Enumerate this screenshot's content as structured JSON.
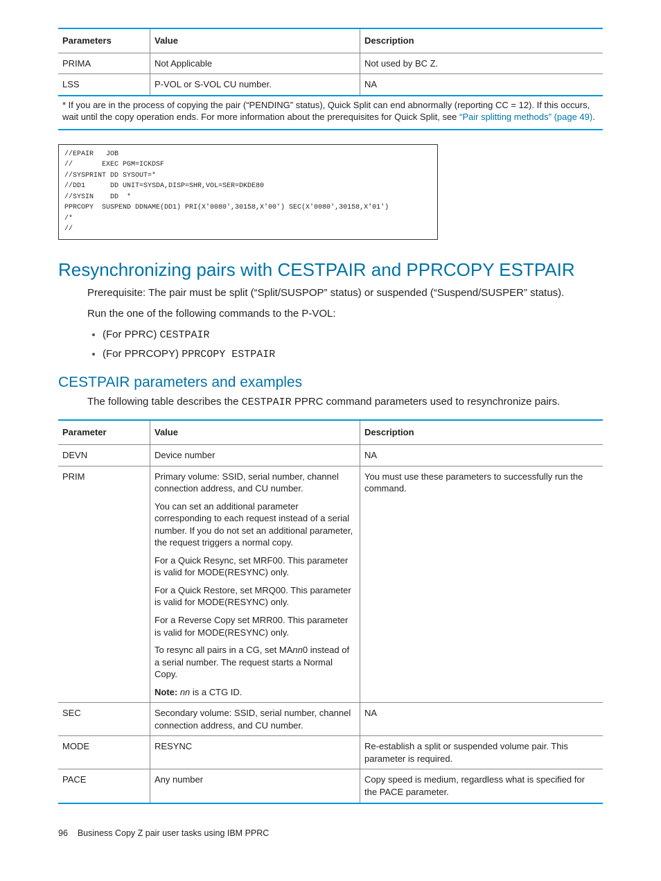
{
  "table1": {
    "headers": [
      "Parameters",
      "Value",
      "Description"
    ],
    "rows": [
      [
        "PRIMA",
        "Not Applicable",
        "Not used by BC Z."
      ],
      [
        "LSS",
        "P-VOL or S-VOL CU number.",
        "NA"
      ]
    ],
    "footnote_pre": "* If you are in the process of copying the pair (“PENDING” status), Quick Split can end abnormally (reporting CC = 12). If this occurs, wait until the copy operation ends. For more information about the prerequisites for Quick Split, see ",
    "footnote_link": "“Pair splitting methods” (page 49)",
    "footnote_post": "."
  },
  "code_block": "//EPAIR   JOB\n//       EXEC PGM=ICKDSF\n//SYSPRINT DD SYSOUT=*\n//DD1      DD UNIT=SYSDA,DISP=SHR,VOL=SER=DKDE80\n//SYSIN    DD  *\nPPRCOPY  SUSPEND DDNAME(DD1) PRI(X'0080',30158,X'00') SEC(X'0080',30158,X'01')\n/*\n//",
  "section1": {
    "title": "Resynchronizing pairs with CESTPAIR and PPRCOPY ESTPAIR",
    "prereq": "Prerequisite: The pair must be split (“Split/SUSPOP” status) or suspended (“Suspend/SUSPER” status).",
    "run": "Run the one of the following commands to the P-VOL:",
    "bullet1_a": "(For PPRC) ",
    "bullet1_b": "CESTPAIR",
    "bullet2_a": "(For PPRCOPY) ",
    "bullet2_b": "PPRCOPY ESTPAIR"
  },
  "section2": {
    "title": "CESTPAIR parameters and examples",
    "intro_a": "The following table describes the ",
    "intro_b": "CESTPAIR",
    "intro_c": " PPRC command parameters used to resynchronize pairs."
  },
  "table2": {
    "headers": [
      "Parameter",
      "Value",
      "Description"
    ],
    "row_devn": {
      "p": "DEVN",
      "v": "Device number",
      "d": "NA"
    },
    "row_prim": {
      "p": "PRIM",
      "v1": "Primary volume: SSID, serial number, channel connection address, and CU number.",
      "v2": "You can set an additional parameter corresponding to each request instead of a serial number. If you do not set an additional parameter, the request triggers a normal copy.",
      "v3": "For a Quick Resync, set MRF00. This parameter is valid for MODE(RESYNC) only.",
      "v4": "For a Quick Restore, set MRQ00. This parameter is valid for MODE(RESYNC) only.",
      "v5": "For a Reverse Copy set MRR00. This parameter is valid for MODE(RESYNC) only.",
      "v6a": "To resync all pairs in a CG, set MA",
      "v6b": "nn",
      "v6c": "0 instead of a serial number. The request starts a Normal Copy.",
      "v7a": "Note:",
      "v7b": " nn",
      "v7c": " is a CTG ID.",
      "d": "You must use these parameters to successfully run the command."
    },
    "row_sec": {
      "p": "SEC",
      "v": "Secondary volume: SSID, serial number, channel connection address, and CU number.",
      "d": "NA"
    },
    "row_mode": {
      "p": "MODE",
      "v": "RESYNC",
      "d": "Re-establish a split or suspended volume pair. This parameter is required."
    },
    "row_pace": {
      "p": "PACE",
      "v": "Any number",
      "d": "Copy speed is medium, regardless what is specified for the PACE parameter."
    }
  },
  "footer": {
    "page": "96",
    "title": "Business Copy Z pair user tasks using IBM PPRC"
  }
}
